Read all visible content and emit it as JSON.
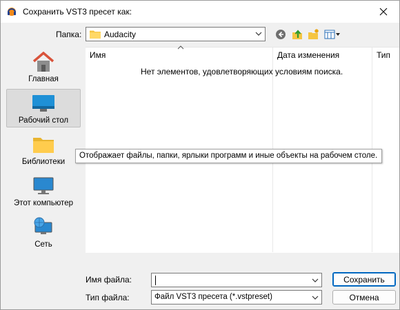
{
  "window": {
    "title": "Сохранить VST3 пресет как:"
  },
  "toolbar": {
    "folder_label": "Папка:",
    "folder_value": "Audacity",
    "back_icon": "back-arrow-icon",
    "up_icon": "up-folder-icon",
    "new_folder_icon": "new-folder-icon",
    "view_icon": "view-menu-icon"
  },
  "places": [
    {
      "label": "Главная",
      "icon": "home-icon"
    },
    {
      "label": "Рабочий стол",
      "icon": "desktop-icon",
      "selected": true
    },
    {
      "label": "Библиотеки",
      "icon": "libraries-icon"
    },
    {
      "label": "Этот компьютер",
      "icon": "computer-icon"
    },
    {
      "label": "Сеть",
      "icon": "network-icon"
    }
  ],
  "filelist": {
    "columns": [
      "Имя",
      "Дата изменения",
      "Тип"
    ],
    "empty_message": "Нет элементов, удовлетворяющих условиям поиска."
  },
  "tooltip": "Отображает файлы, папки, ярлыки программ и иные объекты на рабочем столе.",
  "form": {
    "filename_label": "Имя файла:",
    "filename_value": "",
    "filetype_label": "Тип файла:",
    "filetype_value": "Файл VST3 пресета (*.vstpreset)",
    "save_label": "Сохранить",
    "cancel_label": "Отмена"
  },
  "colors": {
    "accent": "#0067c0",
    "folder": "#f5c542",
    "desktop": "#1e90d6"
  }
}
